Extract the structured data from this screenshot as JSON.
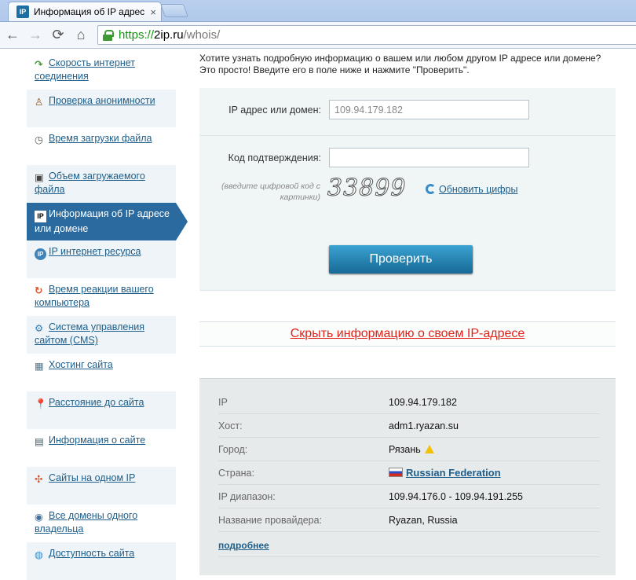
{
  "browser": {
    "tab_title": "Информация об IP адрес",
    "favicon_text": "IP",
    "url_scheme": "https://",
    "url_host": "2ip.ru",
    "url_path": "/whois/"
  },
  "sidebar": {
    "items": [
      {
        "label": "Скорость интернет соединения",
        "icon": "speed-arrow-icon"
      },
      {
        "label": "Проверка анонимности",
        "icon": "person-icon"
      },
      {
        "label": "Время загрузки файла",
        "icon": "clock-icon"
      },
      {
        "label": "Объем загружаемого файла",
        "icon": "file-icon"
      },
      {
        "label": "Информация об IP адресе или домене",
        "icon": "ip-icon",
        "active": true
      },
      {
        "label": "IP интернет ресурса",
        "icon": "ip-globe-icon"
      },
      {
        "label": "Время реакции вашего компьютера",
        "icon": "refresh-colored-icon"
      },
      {
        "label": "Система управления сайтом (CMS)",
        "icon": "gear-globe-icon"
      },
      {
        "label": "Хостинг сайта",
        "icon": "grid-icon"
      },
      {
        "label": "Расстояние до сайта",
        "icon": "map-pin-icon"
      },
      {
        "label": "Информация о сайте",
        "icon": "document-icon"
      },
      {
        "label": "Сайты на одном IP",
        "icon": "network-icon"
      },
      {
        "label": "Все домены одного владельца",
        "icon": "user-globe-icon"
      },
      {
        "label": "Доступность сайта",
        "icon": "globe-user-icon"
      }
    ]
  },
  "intro": {
    "line1": "Хотите узнать подробную информацию о вашем или любом другом IP адресе или домене?",
    "line2": "Это просто! Введите его в поле ниже и нажмите \"Проверить\"."
  },
  "form": {
    "ip_label": "IP адрес или домен:",
    "ip_value": "109.94.179.182",
    "code_label": "Код подтверждения:",
    "code_value": "",
    "hint": "(введите цифровой код с картинки)",
    "captcha": "33899",
    "refresh_label": "Обновить цифры",
    "submit_label": "Проверить"
  },
  "hide_link": "Скрыть информацию о своем IP-адресе",
  "result": {
    "rows": [
      {
        "key": "IP",
        "value": "109.94.179.182"
      },
      {
        "key": "Хост:",
        "value": "adm1.ryazan.su"
      },
      {
        "key": "Город:",
        "value": "Рязань"
      },
      {
        "key": "Страна:",
        "value": "Russian Federation"
      },
      {
        "key": "IP диапазон:",
        "value": "109.94.176.0 - 109.94.191.255"
      },
      {
        "key": "Название провайдера:",
        "value": "Ryazan, Russia"
      }
    ],
    "more_label": "подробнее"
  },
  "colors": {
    "accent": "#2a6a9e",
    "link": "#1d5e8a",
    "hide_link": "#e2231a",
    "button": "#176a97"
  }
}
